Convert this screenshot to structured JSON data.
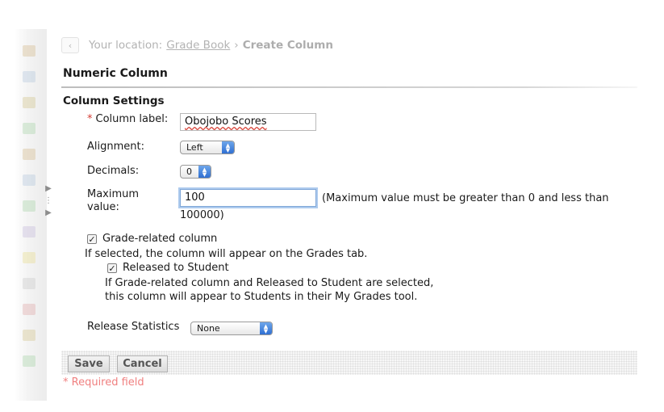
{
  "breadcrumb": {
    "back_label": "‹",
    "prefix": "Your location:",
    "link": "Grade Book",
    "separator": "›",
    "current": "Create Column"
  },
  "page_title": "Numeric Column",
  "section_title": "Column Settings",
  "form": {
    "required_star": "*",
    "column_label": {
      "label": "Column label:",
      "value": "Obojobo Scores"
    },
    "alignment": {
      "label": "Alignment:",
      "value": "Left"
    },
    "decimals": {
      "label": "Decimals:",
      "value": "0"
    },
    "max_value": {
      "label_line1": "Maximum",
      "label_line2": "value:",
      "value": "100",
      "hint_line1": "(Maximum value must be greater than 0 and less than",
      "hint_line2": "100000)"
    },
    "grade_related": {
      "label": "Grade-related column",
      "checked": true,
      "help": "If selected, the column will appear on the Grades tab."
    },
    "released": {
      "label": "Released to Student",
      "checked": true,
      "help_line1": "If Grade-related column and Released to Student are selected,",
      "help_line2": "this column will appear to Students in their My Grades tool."
    },
    "release_statistics": {
      "label": "Release Statistics",
      "value": "None"
    }
  },
  "buttons": {
    "save": "Save",
    "cancel": "Cancel"
  },
  "required_note": "* Required field",
  "colors": {
    "required_red": "#d43b32",
    "required_note_pink": "#f08080",
    "focus_blue": "#7fa7d8",
    "select_arrow_blue": "#2f6fd2"
  }
}
